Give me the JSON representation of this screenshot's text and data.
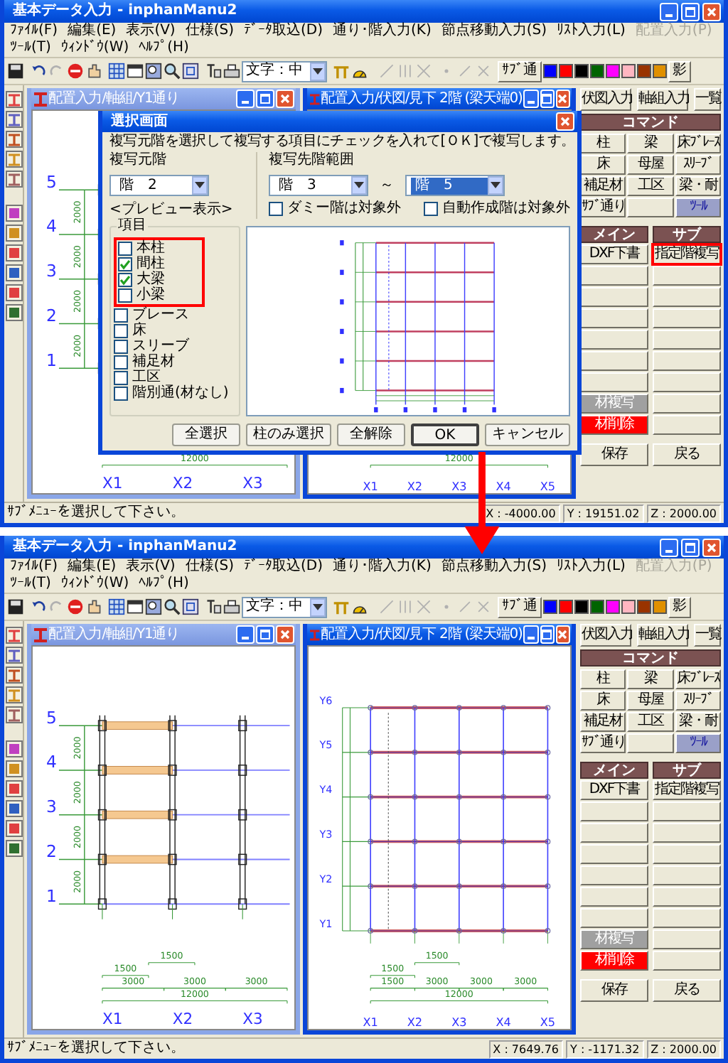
{
  "screens": [
    {
      "window": {
        "title": "基本データ入力 - inphanManu2"
      },
      "menu": [
        {
          "label": "ﾌｧｲﾙ(F)",
          "disabled": false
        },
        {
          "label": "編集(E)",
          "disabled": false
        },
        {
          "label": "表示(V)",
          "disabled": false
        },
        {
          "label": "仕様(S)",
          "disabled": false
        },
        {
          "label": "ﾃﾞｰﾀ取込(D)",
          "disabled": false
        },
        {
          "label": "通り･階入力(K)",
          "disabled": false
        },
        {
          "label": "節点移動入力(S)",
          "disabled": false
        },
        {
          "label": "ﾘｽﾄ入力(L)",
          "disabled": false
        },
        {
          "label": "配置入力(P)",
          "disabled": true
        },
        {
          "label": "ﾂｰﾙ(T)",
          "disabled": false
        },
        {
          "label": "ｳｨﾝﾄﾞｳ(W)",
          "disabled": false
        },
        {
          "label": "ﾍﾙﾌﾟ(H)",
          "disabled": false
        }
      ],
      "toolbar": {
        "text_size": "文字：中",
        "sub_grid": "ｻﾌﾞ通",
        "swatches": [
          {
            "color": "#0000ff"
          },
          {
            "color": "#ff0000"
          },
          {
            "color": "#000000"
          },
          {
            "color": "#006400"
          },
          {
            "color": "#ff00ff"
          },
          {
            "color": "#ffb6c1"
          },
          {
            "color": "#993300"
          },
          {
            "color": "#e09000"
          }
        ],
        "shadow": "影"
      },
      "child_windows": [
        {
          "title": "配置入力/軸組/Y1通り",
          "active": false,
          "drawing": {
            "kind": "elevation",
            "level_labels": [
              "5",
              "4",
              "3",
              "2",
              "1"
            ],
            "vertical_dims": [
              "2000",
              "2000",
              "2000",
              "2000"
            ],
            "dimension_rows": [
              [
                "12000"
              ]
            ],
            "x_labels": [
              "X1",
              "X2",
              "X3"
            ]
          }
        },
        {
          "title": "配置入力/伏図/見下 2階 (梁天端0)",
          "active": true,
          "drawing": {
            "kind": "plan",
            "dimension_rows": [
              [
                "12000"
              ]
            ],
            "x_labels": [
              "X1",
              "X2",
              "X3",
              "X4",
              "X5"
            ]
          }
        }
      ],
      "panel": {
        "tabs": [
          "伏図入力",
          "軸組入力",
          "一覧"
        ],
        "command_header": "コマンド",
        "commands": [
          {
            "label": "柱",
            "selected": false
          },
          {
            "label": "梁",
            "selected": false
          },
          {
            "label": "床ﾌﾞﾚｰｽ",
            "selected": false
          },
          {
            "label": "床",
            "selected": false
          },
          {
            "label": "母屋",
            "selected": false
          },
          {
            "label": "ｽﾘｰﾌﾞ",
            "selected": false
          },
          {
            "label": "補足材",
            "selected": false
          },
          {
            "label": "工区",
            "selected": false
          },
          {
            "label": "梁・耐",
            "selected": false
          },
          {
            "label": "ｻﾌﾞ通り",
            "selected": false
          },
          {
            "selected": false
          },
          {
            "label": "ﾂｰﾙ",
            "selected": true
          }
        ],
        "main_header": "メイン",
        "sub_header": "サブ",
        "main_buttons": [
          {
            "kind": "normal",
            "label": "DXF下書"
          },
          {
            "kind": "normal"
          },
          {
            "kind": "normal"
          },
          {
            "kind": "normal"
          },
          {
            "kind": "normal"
          },
          {
            "kind": "normal"
          },
          {
            "kind": "normal"
          },
          {
            "kind": "grey",
            "label": "材複写"
          },
          {
            "kind": "danger",
            "label": "材削除"
          }
        ],
        "sub_buttons": [
          {
            "label": "指定階複写",
            "highlighted": true
          },
          {
            "highlighted": false
          },
          {
            "highlighted": false
          },
          {
            "highlighted": false
          },
          {
            "highlighted": false
          },
          {
            "highlighted": false
          },
          {
            "highlighted": false
          },
          {
            "highlighted": false
          },
          {
            "highlighted": false
          }
        ],
        "footer": [
          "保存",
          "戻る"
        ]
      },
      "status_bar": {
        "message": "ｻﾌﾞﾒﾆｭｰを選択して下さい。",
        "x": "X : -4000.00",
        "y": "Y : 19151.02",
        "z": "Z : 2000.00"
      },
      "dialog": {
        "title": "選択画面",
        "instruction": "複写元階を選択して複写する項目にチェックを入れて[ＯＫ]で複写します。",
        "source_label": "複写元階",
        "source": {
          "value": "階　2",
          "focused": false
        },
        "target_label": "複写先階範囲",
        "target_from": {
          "value": "階　3",
          "focused": false
        },
        "range_sep": "～",
        "target_to": {
          "value": "階　5",
          "focused": true
        },
        "options": [
          {
            "label": "ダミー階は対象外",
            "checked": false
          },
          {
            "label": "自動作成階は対象外",
            "checked": false
          }
        ],
        "preview_label": "<プレビュー表示>",
        "items_label": "項目",
        "items": [
          {
            "label": "本柱",
            "checked": false,
            "highlighted": true
          },
          {
            "label": "間柱",
            "checked": true,
            "highlighted": true
          },
          {
            "label": "大梁",
            "checked": true,
            "highlighted": true
          },
          {
            "label": "小梁",
            "checked": false,
            "highlighted": true
          },
          {
            "label": "ブレース",
            "checked": false,
            "highlighted": false
          },
          {
            "label": "床",
            "checked": false,
            "highlighted": false
          },
          {
            "label": "スリーブ",
            "checked": false,
            "highlighted": false
          },
          {
            "label": "補足材",
            "checked": false,
            "highlighted": false
          },
          {
            "label": "工区",
            "checked": false,
            "highlighted": false
          },
          {
            "label": "階別通(材なし)",
            "checked": false,
            "highlighted": false
          }
        ],
        "buttons": [
          {
            "label": "全選択",
            "default": false
          },
          {
            "label": "柱のみ選択",
            "default": false
          },
          {
            "label": "全解除",
            "default": false
          },
          {
            "label": "OK",
            "default": true
          },
          {
            "label": "キャンセル",
            "default": false
          }
        ]
      }
    },
    {
      "window": {
        "title": "基本データ入力 - inphanManu2"
      },
      "menu": [
        {
          "label": "ﾌｧｲﾙ(F)",
          "disabled": false
        },
        {
          "label": "編集(E)",
          "disabled": false
        },
        {
          "label": "表示(V)",
          "disabled": false
        },
        {
          "label": "仕様(S)",
          "disabled": false
        },
        {
          "label": "ﾃﾞｰﾀ取込(D)",
          "disabled": false
        },
        {
          "label": "通り･階入力(K)",
          "disabled": false
        },
        {
          "label": "節点移動入力(S)",
          "disabled": false
        },
        {
          "label": "ﾘｽﾄ入力(L)",
          "disabled": false
        },
        {
          "label": "配置入力(P)",
          "disabled": true
        },
        {
          "label": "ﾂｰﾙ(T)",
          "disabled": false
        },
        {
          "label": "ｳｨﾝﾄﾞｳ(W)",
          "disabled": false
        },
        {
          "label": "ﾍﾙﾌﾟ(H)",
          "disabled": false
        }
      ],
      "toolbar": {
        "text_size": "文字：中",
        "sub_grid": "ｻﾌﾞ通",
        "swatches": [
          {
            "color": "#0000ff"
          },
          {
            "color": "#ff0000"
          },
          {
            "color": "#000000"
          },
          {
            "color": "#006400"
          },
          {
            "color": "#ff00ff"
          },
          {
            "color": "#ffb6c1"
          },
          {
            "color": "#993300"
          },
          {
            "color": "#e09000"
          }
        ],
        "shadow": "影"
      },
      "child_windows": [
        {
          "title": "配置入力/軸組/Y1通り",
          "active": false,
          "drawing": {
            "kind": "elevation",
            "level_labels": [
              "5",
              "4",
              "3",
              "2",
              "1"
            ],
            "vertical_dims": [
              "2000",
              "2000",
              "2000",
              "2000"
            ],
            "dimension_rows": [
              [
                "1500"
              ],
              [
                "1500"
              ],
              [
                "3000",
                "3000",
                "3000"
              ],
              [
                "12000"
              ]
            ],
            "x_labels": [
              "X1",
              "X2",
              "X3"
            ]
          }
        },
        {
          "title": "配置入力/伏図/見下 2階 (梁天端0)",
          "active": true,
          "drawing": {
            "kind": "plan",
            "y_labels": [
              "Y6",
              "Y5",
              "Y4",
              "Y3",
              "Y2",
              "Y1"
            ],
            "dimension_rows": [
              [
                "1500"
              ],
              [
                "1500"
              ],
              [
                "1500",
                "3000",
                "3000",
                "3000"
              ],
              [
                "12000"
              ]
            ],
            "x_labels": [
              "X1",
              "X2",
              "X3",
              "X4",
              "X5"
            ]
          }
        }
      ],
      "panel": {
        "tabs": [
          "伏図入力",
          "軸組入力",
          "一覧"
        ],
        "command_header": "コマンド",
        "commands": [
          {
            "label": "柱",
            "selected": false
          },
          {
            "label": "梁",
            "selected": false
          },
          {
            "label": "床ﾌﾞﾚｰｽ",
            "selected": false
          },
          {
            "label": "床",
            "selected": false
          },
          {
            "label": "母屋",
            "selected": false
          },
          {
            "label": "ｽﾘｰﾌﾞ",
            "selected": false
          },
          {
            "label": "補足材",
            "selected": false
          },
          {
            "label": "工区",
            "selected": false
          },
          {
            "label": "梁・耐",
            "selected": false
          },
          {
            "label": "ｻﾌﾞ通り",
            "selected": false
          },
          {
            "selected": false
          },
          {
            "label": "ﾂｰﾙ",
            "selected": true
          }
        ],
        "main_header": "メイン",
        "sub_header": "サブ",
        "main_buttons": [
          {
            "kind": "normal",
            "label": "DXF下書"
          },
          {
            "kind": "normal"
          },
          {
            "kind": "normal"
          },
          {
            "kind": "normal"
          },
          {
            "kind": "normal"
          },
          {
            "kind": "normal"
          },
          {
            "kind": "normal"
          },
          {
            "kind": "grey",
            "label": "材複写"
          },
          {
            "kind": "danger",
            "label": "材削除"
          }
        ],
        "sub_buttons": [
          {
            "label": "指定階複写",
            "highlighted": false
          },
          {
            "highlighted": false
          },
          {
            "highlighted": false
          },
          {
            "highlighted": false
          },
          {
            "highlighted": false
          },
          {
            "highlighted": false
          },
          {
            "highlighted": false
          },
          {
            "highlighted": false
          },
          {
            "highlighted": false
          }
        ],
        "footer": [
          "保存",
          "戻る"
        ]
      },
      "status_bar": {
        "message": "ｻﾌﾞﾒﾆｭｰを選択して下さい。",
        "x": "X : 7649.76",
        "y": "Y : -1171.32",
        "z": "Z : 2000.00"
      }
    }
  ]
}
